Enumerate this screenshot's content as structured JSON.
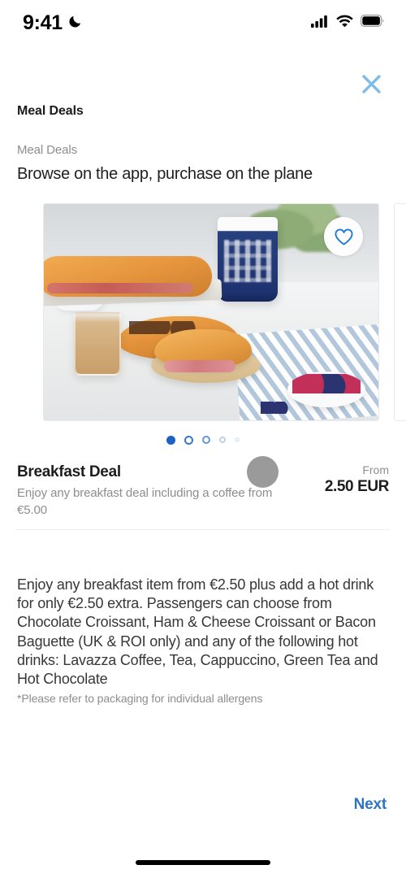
{
  "status_bar": {
    "time": "9:41",
    "dnd_icon": "crescent-moon-icon",
    "cellular_icon": "signal-bars-icon",
    "wifi_icon": "wifi-icon",
    "battery_icon": "battery-full-icon"
  },
  "header": {
    "close_icon": "close-x-icon",
    "title": "Meal Deals"
  },
  "section": {
    "eyebrow": "Meal Deals",
    "heading": "Browse on the app, purchase on the plane"
  },
  "carousel": {
    "favorite_icon": "heart-outline-icon",
    "image_alt": "Breakfast spread with bacon baguette, ham and cheese croissant, chocolate croissant, coffee and berries",
    "page_count": 5,
    "active_page": 1,
    "dots": [
      {
        "state": "active",
        "size": 11,
        "opacity": 1
      },
      {
        "state": "inactive",
        "size": 11,
        "opacity": 1
      },
      {
        "state": "inactive",
        "size": 10,
        "opacity": 0.85
      },
      {
        "state": "inactive",
        "size": 8,
        "opacity": 0.5
      },
      {
        "state": "inactive",
        "size": 6,
        "opacity": 0.32
      }
    ]
  },
  "deal": {
    "name": "Breakfast Deal",
    "subtitle": "Enjoy any breakfast deal including a coffee from €5.00",
    "price_label": "From",
    "price_value": "2.50 EUR"
  },
  "description": {
    "body": "Enjoy any breakfast item from €2.50 plus add a hot drink for only €2.50 extra. Passengers can choose from Chocolate Croissant, Ham & Cheese Croissant or Bacon Baguette (UK & ROI only) and any of the following hot drinks: Lavazza Coffee, Tea, Cappuccino, Green Tea and Hot Chocolate",
    "allergen_note": "*Please refer to packaging for individual allergens"
  },
  "footer": {
    "next_label": "Next"
  },
  "colors": {
    "accent_blue": "#2f74c0",
    "close_blue": "#7fbcea",
    "dot_active": "#1a63c4",
    "muted_text": "#8d8d8d",
    "primary_text": "#1d1d1d",
    "divider": "#ededf2",
    "cursor": "#9a9a9a"
  }
}
